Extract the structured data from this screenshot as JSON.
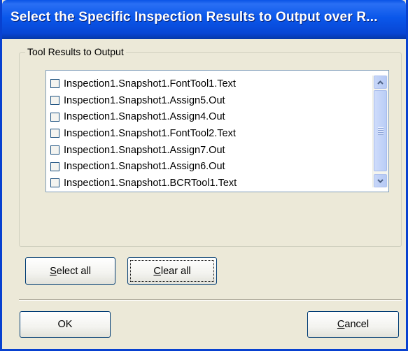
{
  "window": {
    "title": "Select the Specific Inspection Results to Output over R..."
  },
  "group": {
    "legend": "Tool Results to Output"
  },
  "list": {
    "items": [
      {
        "label": "Inspection1.Snapshot1.FontTool1.Text",
        "checked": false
      },
      {
        "label": "Inspection1.Snapshot1.Assign5.Out",
        "checked": false
      },
      {
        "label": "Inspection1.Snapshot1.Assign4.Out",
        "checked": false
      },
      {
        "label": "Inspection1.Snapshot1.FontTool2.Text",
        "checked": false
      },
      {
        "label": "Inspection1.Snapshot1.Assign7.Out",
        "checked": false
      },
      {
        "label": "Inspection1.Snapshot1.Assign6.Out",
        "checked": false
      },
      {
        "label": "Inspection1.Snapshot1.BCRTool1.Text",
        "checked": false
      }
    ]
  },
  "buttons": {
    "select_all": {
      "mnemonic": "S",
      "rest": "elect all"
    },
    "clear_all": {
      "mnemonic": "C",
      "rest": "lear all"
    },
    "ok": "OK",
    "cancel": {
      "mnemonic": "C",
      "rest": "ancel"
    }
  },
  "icons": {
    "scroll_up": "chevron-up-icon",
    "scroll_down": "chevron-down-icon"
  }
}
